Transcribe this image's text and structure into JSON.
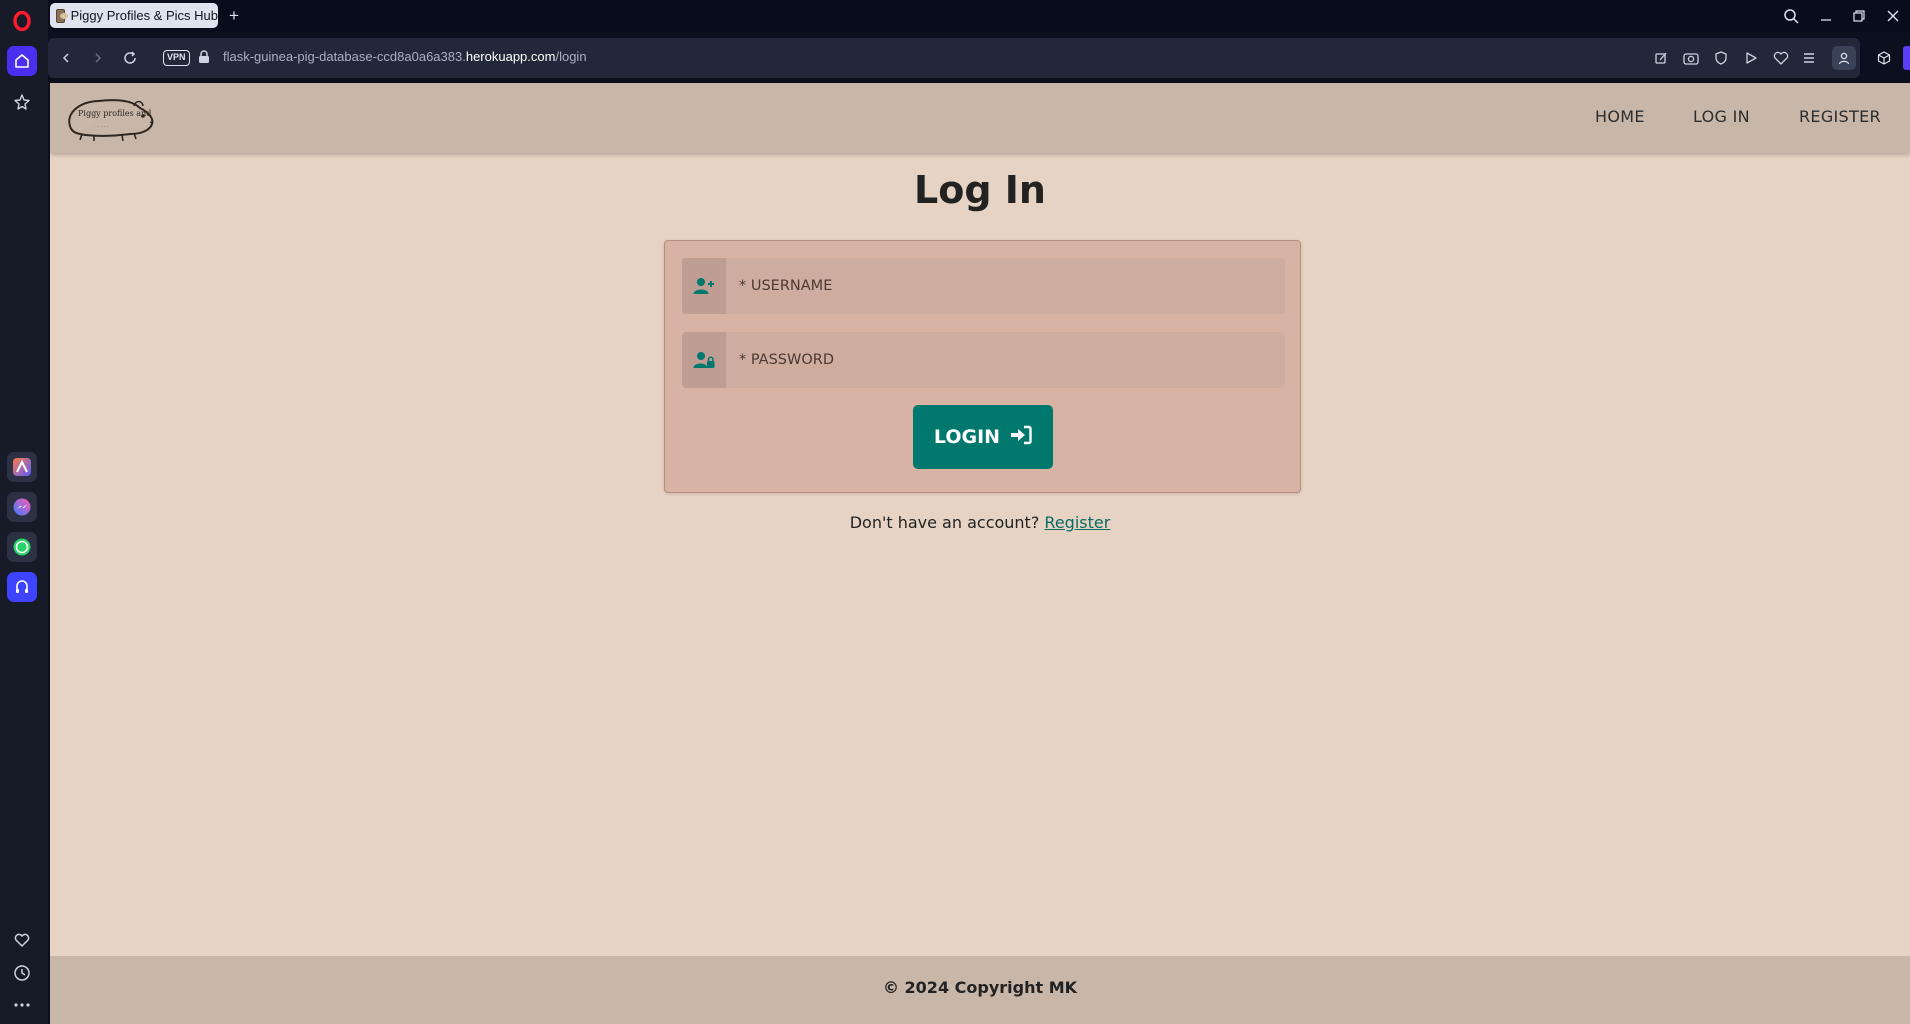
{
  "browser": {
    "tab_title": "Piggy Profiles & Pics Hub",
    "new_tab_symbol": "+",
    "vpn_label": "VPN",
    "url": {
      "subdomain": "flask-guinea-pig-database-ccd8a0a6a383.",
      "domain": "herokuapp.com",
      "path": "/login"
    }
  },
  "site": {
    "logo_text": "Piggy profiles and",
    "nav": {
      "home": "HOME",
      "login": "LOG IN",
      "register": "REGISTER"
    },
    "page_title": "Log In",
    "form": {
      "username_placeholder": "* USERNAME",
      "password_placeholder": "* PASSWORD",
      "login_button": "LOGIN"
    },
    "register_prompt": "Don't have an account?",
    "register_link": "Register",
    "footer": "© 2024 Copyright MK"
  },
  "colors": {
    "page_bg": "#e6d3c4",
    "nav_bg": "#c8b7a8",
    "card_bg": "#d8b3a3",
    "accent": "#00786e",
    "browser_bg": "#080c1b"
  },
  "icons": {
    "sidebar": [
      "opera-logo-icon",
      "home-icon",
      "pinboards-icon",
      "aria-icon",
      "messenger-icon",
      "whatsapp-icon",
      "music-player-icon",
      "heart-icon",
      "history-icon",
      "more-icon"
    ],
    "toolbar": [
      "snapshot-icon",
      "camera-icon",
      "shield-icon",
      "flow-icon",
      "heart-icon",
      "easy-setup-icon",
      "profile-icon",
      "extensions-icon"
    ],
    "username_field": "user-plus-icon",
    "password_field": "user-lock-icon",
    "login_button": "sign-in-icon"
  }
}
